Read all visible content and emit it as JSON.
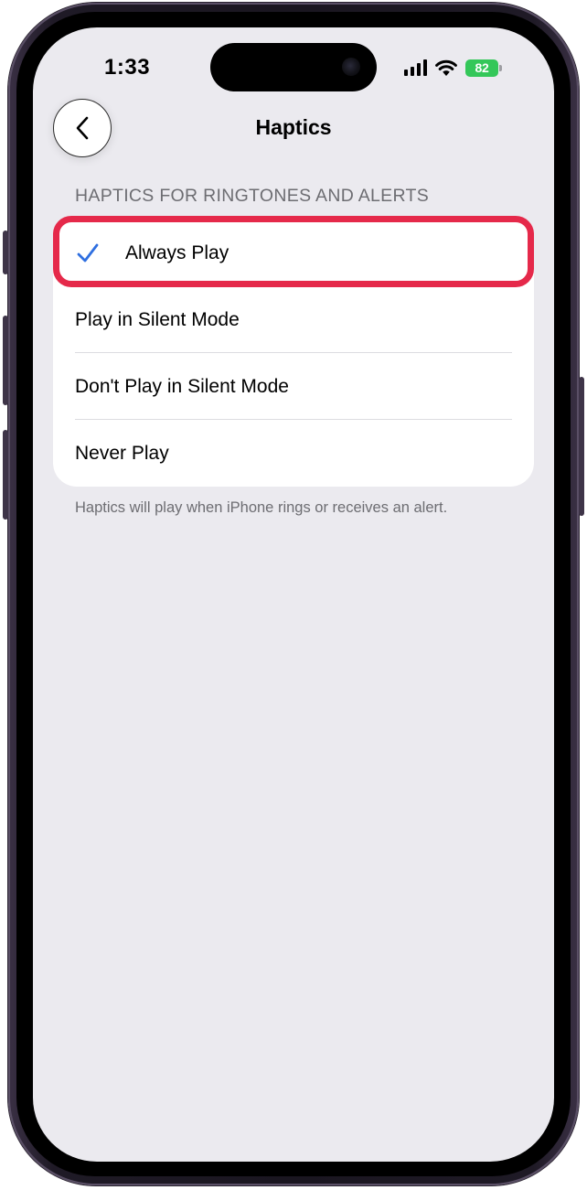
{
  "status_bar": {
    "time": "1:33",
    "battery_level": "82",
    "battery_color": "#34c759",
    "icons": [
      "cellular-signal-icon",
      "wifi-icon",
      "battery-charging-icon"
    ]
  },
  "nav": {
    "back_icon": "chevron-left-icon",
    "title": "Haptics"
  },
  "section": {
    "header": "HAPTICS FOR RINGTONES AND ALERTS",
    "options": [
      {
        "label": "Always Play",
        "selected": true
      },
      {
        "label": "Play in Silent Mode",
        "selected": false
      },
      {
        "label": "Don't Play in Silent Mode",
        "selected": false
      },
      {
        "label": "Never Play",
        "selected": false
      }
    ],
    "footer": "Haptics will play when iPhone rings or receives an alert."
  },
  "colors": {
    "accent": "#2f6fe0",
    "highlight": "#e5294a",
    "background": "#ebeaef"
  }
}
